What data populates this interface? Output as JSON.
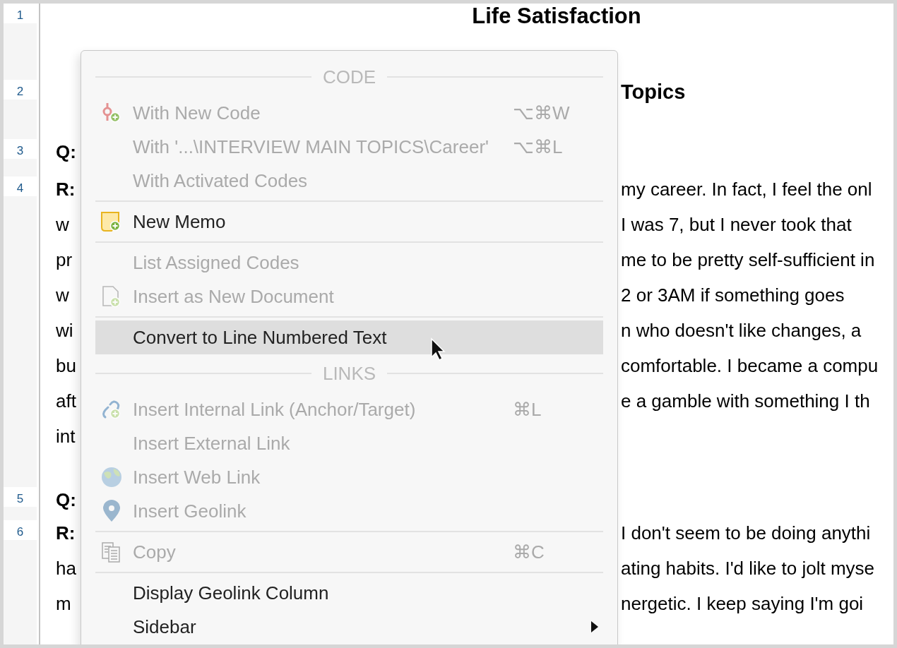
{
  "document": {
    "paragraphs": [
      {
        "number": "1",
        "lines": [
          {
            "kind": "title",
            "text": "Life Satisfaction"
          }
        ]
      },
      {
        "number": "2",
        "lines": [
          {
            "kind": "heading",
            "end": "Topics"
          }
        ]
      },
      {
        "number": "3",
        "lines": [
          {
            "kind": "text",
            "start": "Q:",
            "start_bold": true
          }
        ]
      },
      {
        "number": "4",
        "lines": [
          {
            "kind": "text",
            "start": "R:",
            "start_bold": true,
            "end": "my career. In fact, I feel the onl"
          },
          {
            "kind": "text",
            "start": "w",
            "start_bold": false,
            "end": "I was 7, but I never took that"
          },
          {
            "kind": "text",
            "start": "pr",
            "start_bold": false,
            "end": "me to be pretty self-sufficient in"
          },
          {
            "kind": "text",
            "start": "w",
            "start_bold": false,
            "end": "2 or 3AM if something goes"
          },
          {
            "kind": "text",
            "start": "wi",
            "start_bold": false,
            "end": "n who doesn't like changes, a"
          },
          {
            "kind": "text",
            "start": "bu",
            "start_bold": false,
            "end": "comfortable. I became a compu"
          },
          {
            "kind": "text",
            "start": "aft",
            "start_bold": false,
            "end": "e a gamble with something I th"
          },
          {
            "kind": "text",
            "start": "int",
            "start_bold": false
          }
        ]
      },
      {
        "number": "5",
        "lines": [
          {
            "kind": "text",
            "start": "Q:",
            "start_bold": true
          }
        ]
      },
      {
        "number": "6",
        "lines": [
          {
            "kind": "text",
            "start": "R:",
            "start_bold": true,
            "end": "I don't seem to be doing anythi"
          },
          {
            "kind": "text",
            "start": "ha",
            "start_bold": false,
            "end": "ating habits. I'd like to jolt myse"
          },
          {
            "kind": "text",
            "start": "m",
            "start_bold": false,
            "end": "nergetic. I keep saying I'm goi"
          }
        ]
      }
    ]
  },
  "menu": {
    "items": [
      {
        "kind": "header",
        "label": "CODE"
      },
      {
        "kind": "item",
        "label": "With New Code",
        "shortcut": "⌥⌘W",
        "disabled": true,
        "selected": false,
        "submenu": false
      },
      {
        "kind": "item",
        "label": "With '...\\INTERVIEW MAIN TOPICS\\Career'",
        "shortcut": "⌥⌘L",
        "disabled": true,
        "selected": false,
        "submenu": false
      },
      {
        "kind": "item",
        "label": "With Activated Codes",
        "disabled": true,
        "selected": false,
        "submenu": false
      },
      {
        "kind": "separator"
      },
      {
        "kind": "item",
        "label": "New Memo",
        "disabled": false,
        "selected": false,
        "submenu": false
      },
      {
        "kind": "separator"
      },
      {
        "kind": "item",
        "label": "List Assigned Codes",
        "disabled": true,
        "selected": false,
        "submenu": false
      },
      {
        "kind": "item",
        "label": "Insert as New Document",
        "disabled": true,
        "selected": false,
        "submenu": false
      },
      {
        "kind": "separator"
      },
      {
        "kind": "item",
        "label": "Convert to Line Numbered Text",
        "disabled": false,
        "selected": true,
        "submenu": false
      },
      {
        "kind": "header",
        "label": "LINKS"
      },
      {
        "kind": "item",
        "label": "Insert Internal Link (Anchor/Target)",
        "shortcut": "⌘L",
        "disabled": true,
        "selected": false,
        "submenu": false
      },
      {
        "kind": "item",
        "label": "Insert External Link",
        "disabled": true,
        "selected": false,
        "submenu": false
      },
      {
        "kind": "item",
        "label": "Insert Web Link",
        "disabled": true,
        "selected": false,
        "submenu": false
      },
      {
        "kind": "item",
        "label": "Insert Geolink",
        "disabled": true,
        "selected": false,
        "submenu": false
      },
      {
        "kind": "separator"
      },
      {
        "kind": "item",
        "label": "Copy",
        "shortcut": "⌘C",
        "disabled": true,
        "selected": false,
        "submenu": false
      },
      {
        "kind": "separator"
      },
      {
        "kind": "item",
        "label": "Display Geolink Column",
        "disabled": false,
        "selected": false,
        "submenu": false
      },
      {
        "kind": "item",
        "label": "Sidebar",
        "disabled": false,
        "selected": false,
        "submenu": true
      }
    ]
  }
}
